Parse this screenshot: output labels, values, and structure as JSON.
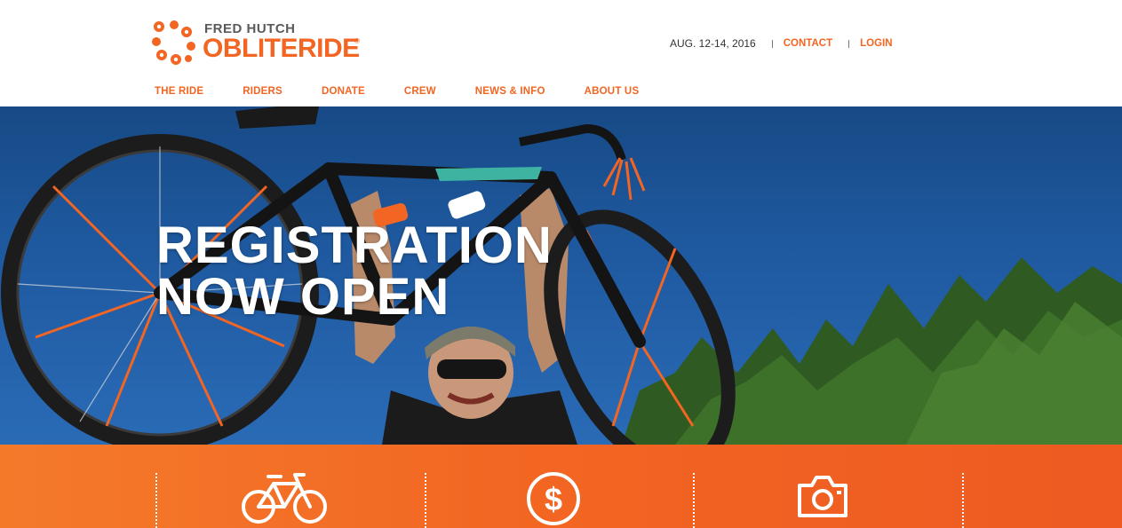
{
  "brand": {
    "top_line": "FRED HUTCH",
    "name": "OBLITERIDE",
    "mark": "®",
    "color": "#f26522"
  },
  "utility": {
    "date": "AUG. 12-14, 2016",
    "contact_label": "CONTACT",
    "login_label": "LOGIN"
  },
  "nav": {
    "items": [
      "THE RIDE",
      "RIDERS",
      "DONATE",
      "CREW",
      "NEWS & INFO",
      "ABOUT US"
    ]
  },
  "hero": {
    "line1": "REGISTRATION",
    "line2": "NOW OPEN"
  },
  "features": {
    "icons": [
      "bicycle-icon",
      "dollar-icon",
      "camera-icon"
    ],
    "band_color": "#f26522"
  }
}
